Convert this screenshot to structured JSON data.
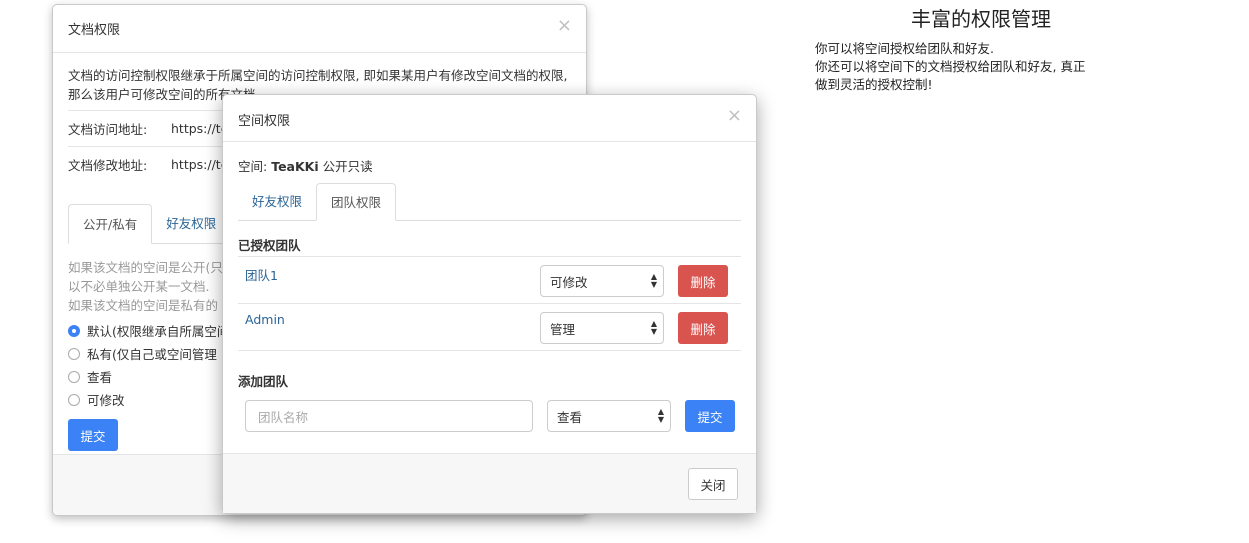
{
  "doc_modal": {
    "title": "文档权限",
    "close_glyph": "×",
    "description": "文档的访问控制权限继承于所属空间的访问控制权限, 即如果某用户有修改空间文档的权限, 那么该用户可修改空间的所有文档.",
    "access_label": "文档访问地址:",
    "access_value": "https://te",
    "edit_label": "文档修改地址:",
    "edit_value": "https://te",
    "tabs": [
      {
        "label": "公开/私有",
        "active": true
      },
      {
        "label": "好友权限",
        "active": false
      }
    ],
    "muted_lines": [
      "如果该文档的空间是公开(只",
      "以不必单独公开某一文档.",
      "如果该文档的空间是私有的"
    ],
    "radios": [
      {
        "label": "默认(权限继承自所属空间",
        "checked": true
      },
      {
        "label": "私有(仅自己或空间管理",
        "checked": false
      },
      {
        "label": "查看",
        "checked": false
      },
      {
        "label": "可修改",
        "checked": false
      }
    ],
    "submit_label": "提交"
  },
  "space_modal": {
    "title": "空间权限",
    "close_glyph": "×",
    "space_label": "空间:",
    "space_name": "TeaKKi",
    "space_mode": "公开只读",
    "tabs": [
      {
        "label": "好友权限",
        "active": false
      },
      {
        "label": "团队权限",
        "active": true
      }
    ],
    "authorized_title": "已授权团队",
    "teams": [
      {
        "name": "团队1",
        "permission": "可修改",
        "delete_label": "删除"
      },
      {
        "name": "Admin",
        "permission": "管理",
        "delete_label": "删除"
      }
    ],
    "add_title": "添加团队",
    "add_placeholder": "团队名称",
    "add_permission": "查看",
    "add_submit_label": "提交",
    "close_label": "关闭"
  },
  "feature": {
    "title": "丰富的权限管理",
    "lines": [
      "你可以将空间授权给团队和好友.",
      "你还可以将空间下的文档授权给团队和好友, 真正",
      "做到灵活的授权控制!"
    ]
  },
  "colors": {
    "primary": "#3b82f6",
    "danger": "#d9534f",
    "link": "#2a6496"
  }
}
